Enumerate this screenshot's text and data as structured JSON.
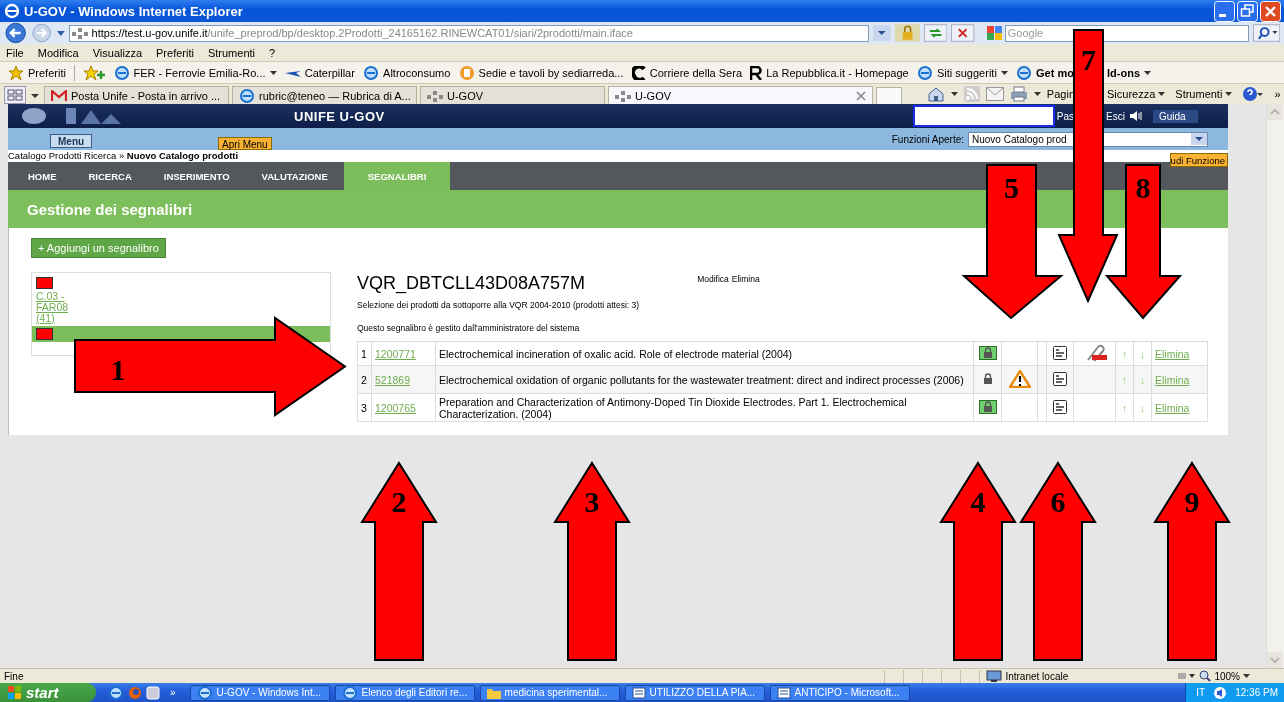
{
  "window": {
    "title": "U-GOV - Windows Internet Explorer"
  },
  "address_bar": {
    "host": "https://test.u-gov.unife.it",
    "path": "/unife_preprod/bp/desktop.2Prodotti_24165162.RINEWCAT01/siari/2prodotti/main.iface"
  },
  "search": {
    "placeholder": "Google"
  },
  "menu_bar": [
    "File",
    "Modifica",
    "Visualizza",
    "Preferiti",
    "Strumenti",
    "?"
  ],
  "favorites_bar": {
    "label": "Preferiti",
    "items": [
      {
        "label": "FER - Ferrovie Emilia-Ro...",
        "dropdown": true,
        "bold": false
      },
      {
        "label": "Caterpillar",
        "dropdown": false,
        "bold": false
      },
      {
        "label": "Altroconsumo",
        "dropdown": false,
        "bold": false
      },
      {
        "label": "Sedie e tavoli by sediarreda...",
        "dropdown": false,
        "bold": false
      },
      {
        "label": "Corriere della Sera",
        "dropdown": false,
        "bold": false
      },
      {
        "label": "La Repubblica.it - Homepage",
        "dropdown": false,
        "bold": false
      },
      {
        "label": "Siti suggeriti",
        "dropdown": true,
        "bold": false
      },
      {
        "label": "Get mo",
        "dropdown": false,
        "bold": true
      }
    ],
    "after_callout": {
      "label": "ld-ons",
      "dropdown": true,
      "bold": true
    }
  },
  "tabs": [
    {
      "label": "Posta Unife - Posta in arrivo ...",
      "selected": false
    },
    {
      "label": "rubric@teneo — Rubrica di A...",
      "selected": false
    },
    {
      "label": "U-GOV",
      "selected": false
    },
    {
      "label": "U-GOV",
      "selected": true
    }
  ],
  "command_bar": {
    "items": [
      {
        "label": "Pagin",
        "dropdown": false
      },
      {
        "label": "Sicurezza",
        "dropdown": true
      },
      {
        "label": "Strumenti",
        "dropdown": true
      }
    ],
    "overflow": "»"
  },
  "app": {
    "title": "UNIFE U-GOV",
    "header_links": [
      "Pas",
      "Esci",
      "Guida"
    ],
    "menu_button": "Menu",
    "open_menu_button": "Apri Menu",
    "open_functions_label": "Funzioni Aperte:",
    "open_functions_value": "Nuovo Catalogo prod",
    "close_function_button": "udi Funzione",
    "breadcrumb": "Catalogo Prodotti Ricerca » **Nuovo Catalogo prodotti**",
    "nav_tabs": [
      {
        "label": "HOME",
        "selected": false
      },
      {
        "label": "RICERCA",
        "selected": false
      },
      {
        "label": "INSERIMENTO",
        "selected": false
      },
      {
        "label": "VALUTAZIONE",
        "selected": false
      },
      {
        "label": "SEGNALIBRI",
        "selected": true
      }
    ],
    "page_title": "Gestione dei segnalibri"
  },
  "bookmarks": {
    "add_button": "+ Aggiungi un segnalibro",
    "list": [
      {
        "label": "C.03 - FAR08 (41)",
        "selected": false
      },
      {
        "selected": true
      }
    ]
  },
  "bookmark_detail": {
    "title": "VQR_DBTCLL43D08A757M",
    "actions": [
      "Modifica",
      "Elimina"
    ],
    "description": "Selezione dei prodotti da sottoporre alla VQR 2004-2010 (prodotti attesi: 3)",
    "note": "Questo segnalibro è gestito dall'amministratore del sistema",
    "rows": [
      {
        "index": "1",
        "code": "1200771",
        "title": "Electrochemical incineration of oxalic acid. Role of electrode material (2004)",
        "lock_highlighted": true,
        "warning": false,
        "attachment": true,
        "up": "↑",
        "down": "↓",
        "action": "Elimina"
      },
      {
        "index": "2",
        "code": "521869",
        "title": "Electrochemical oxidation of organic pollutants for the wastewater treatment: direct and indirect processes (2006)",
        "lock_highlighted": false,
        "warning": true,
        "attachment": false,
        "up": "↑",
        "down": "↓",
        "action": "Elimina"
      },
      {
        "index": "3",
        "code": "1200765",
        "title": "Preparation and Characterization of Antimony-Doped Tin Dioxide Electrodes. Part 1. Electrochemical Characterization. (2004)",
        "lock_highlighted": true,
        "warning": false,
        "attachment": false,
        "up": "↑",
        "down": "↓",
        "action": "Elimina"
      }
    ]
  },
  "callouts": [
    {
      "number": "1",
      "kind": "right"
    },
    {
      "number": "2",
      "kind": "up"
    },
    {
      "number": "3",
      "kind": "up"
    },
    {
      "number": "4",
      "kind": "up"
    },
    {
      "number": "5",
      "kind": "down"
    },
    {
      "number": "6",
      "kind": "up"
    },
    {
      "number": "7",
      "kind": "down"
    },
    {
      "number": "8",
      "kind": "down"
    },
    {
      "number": "9",
      "kind": "up"
    }
  ],
  "status_bar": {
    "text": "Fine",
    "zone": "Intranet locale",
    "zoom": "100%"
  },
  "taskbar": {
    "start": "start",
    "more": "»",
    "items": [
      "U-GOV - Windows Int...",
      "Elenco degli Editori re...",
      "medicina sperimental...",
      "UTILIZZO DELLA PIA...",
      "ANTICIPO - Microsoft..."
    ],
    "language": "IT",
    "clock": "12:36 PM"
  }
}
